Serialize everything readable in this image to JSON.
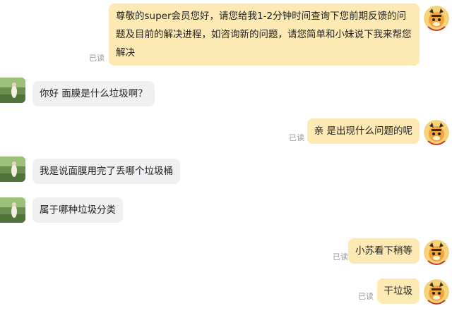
{
  "read_label": "已读",
  "messages": [
    {
      "side": "out",
      "text": "尊敬的super会员您好，请您给我1-2分钟时间查询下您前期反馈的问题及目前的解决进程，如咨询新的问题，请您简单和小妹说下我来帮您解决",
      "read": true
    },
    {
      "side": "in",
      "text": "你好 面膜是什么垃圾啊？"
    },
    {
      "side": "out",
      "text": "亲 是出现什么问题的呢",
      "read": true
    },
    {
      "side": "in",
      "text": "我是说面膜用完了丢哪个垃圾桶"
    },
    {
      "side": "in",
      "text": "属于哪种垃圾分类"
    },
    {
      "side": "out",
      "text": "小苏看下稍等",
      "read": true
    },
    {
      "side": "out",
      "text": "干垃圾",
      "read": true
    }
  ],
  "icons": {
    "left_avatar": "user-photo-avatar",
    "right_avatar": "tiger-mascot-avatar"
  }
}
